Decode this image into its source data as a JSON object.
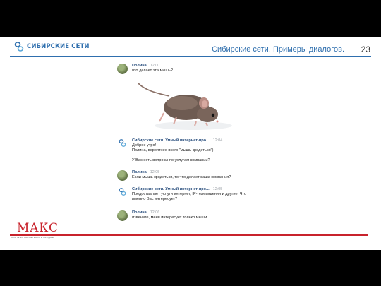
{
  "header": {
    "logo_text": "СИБИРСКИЕ СЕТИ",
    "title": "Сибирские сети. Примеры диалогов.",
    "page_number": "23"
  },
  "messages": [
    {
      "avatar": "user-photo",
      "name": "Полина",
      "time": "12:00",
      "lines": [
        "что делает эта мышь?"
      ]
    },
    {
      "avatar": "company-logo",
      "name": "Сибирские сети. Умный интернет-про...",
      "time": "12:04",
      "lines": [
        "Доброе утро!",
        "Полина, вероятнее всего \"мышь кродеться\")",
        "",
        "У Вас есть вопросы по услугам компании?"
      ]
    },
    {
      "avatar": "user-photo",
      "name": "Полина",
      "time": "12:05",
      "lines": [
        "Если мышь кродеться, то что делает ваша компания?"
      ]
    },
    {
      "avatar": "company-logo",
      "name": "Сибирские сети. Умный интернет-про...",
      "time": "12:05",
      "lines": [
        "Предоставляет услуги интернет, IP-телевидения и другие. Что именно Вас интересует?"
      ]
    },
    {
      "avatar": "user-photo",
      "name": "Полина",
      "time": "12:06",
      "lines": [
        "извените, меня интересует только мыши"
      ]
    }
  ],
  "footer": {
    "logo_text": "МАКС",
    "logo_subtitle": "СИСТЕМА МАРКЕТИНГА И ПРОДАЖ"
  },
  "colors": {
    "brand_blue": "#2f6fae",
    "brand_red": "#c8232c"
  }
}
